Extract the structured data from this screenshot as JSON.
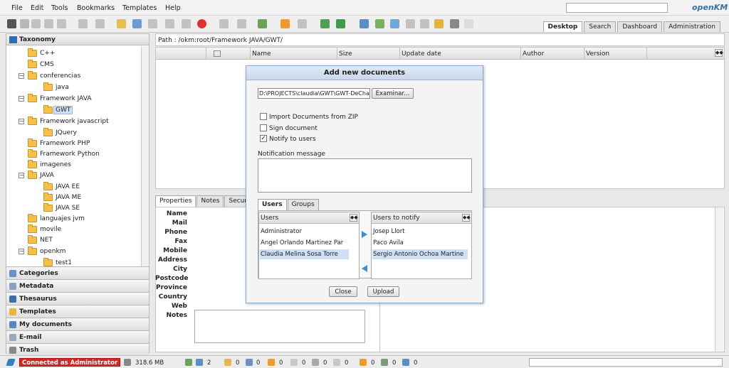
{
  "menu": [
    "File",
    "Edit",
    "Tools",
    "Bookmarks",
    "Templates",
    "Help"
  ],
  "logo": "openKM",
  "top_tabs": [
    {
      "label": "Desktop",
      "active": true
    },
    {
      "label": "Search",
      "active": false
    },
    {
      "label": "Dashboard",
      "active": false
    },
    {
      "label": "Administration",
      "active": false
    }
  ],
  "taxonomy": {
    "title": "Taxonomy",
    "nodes": [
      {
        "label": "C++",
        "expand": ""
      },
      {
        "label": "CMS",
        "expand": ""
      },
      {
        "label": "conferencias",
        "expand": "−"
      },
      {
        "label": "java",
        "expand": ""
      },
      {
        "label": "Framework JAVA",
        "expand": "−"
      },
      {
        "label": "GWT",
        "expand": ""
      },
      {
        "label": "Framework javascript",
        "expand": "−"
      },
      {
        "label": "JQuery",
        "expand": ""
      },
      {
        "label": "Framework PHP",
        "expand": ""
      },
      {
        "label": "Framework Python",
        "expand": ""
      },
      {
        "label": "imagenes",
        "expand": ""
      },
      {
        "label": "JAVA",
        "expand": "−"
      },
      {
        "label": "JAVA EE",
        "expand": ""
      },
      {
        "label": "JAVA ME",
        "expand": ""
      },
      {
        "label": "JAVA SE",
        "expand": ""
      },
      {
        "label": "languajes jvm",
        "expand": ""
      },
      {
        "label": "movile",
        "expand": ""
      },
      {
        "label": "NET",
        "expand": ""
      },
      {
        "label": "openkm",
        "expand": "−"
      },
      {
        "label": "test1",
        "expand": ""
      }
    ]
  },
  "accordion": [
    "Categories",
    "Metadata",
    "Thesaurus",
    "Templates",
    "My documents",
    "E-mail",
    "Trash"
  ],
  "path": "Path : /okm:root/Framework JAVA/GWT/",
  "grid_columns": [
    "Name",
    "Size",
    "Update date",
    "Author",
    "Version"
  ],
  "property_tabs": [
    "Properties",
    "Notes",
    "Security"
  ],
  "property_labels": [
    "Name",
    "Mail",
    "Phone",
    "Fax",
    "Mobile",
    "Address",
    "City",
    "Postcode",
    "Province",
    "Country",
    "Web",
    "Notes"
  ],
  "dialog": {
    "title": "Add new documents",
    "file_value": "D:\\PROJECTS\\claudia\\GWT\\GWT-DeCharla",
    "browse_label": "Examinar...",
    "options": [
      {
        "label": "Import Documents from ZIP",
        "checked": false
      },
      {
        "label": "Sign document",
        "checked": false
      },
      {
        "label": "Notify to users",
        "checked": true
      }
    ],
    "notification_label": "Notification message",
    "tabs": [
      "Users",
      "Groups"
    ],
    "users_header": "Users",
    "users": [
      "Administrator",
      "Angel Orlando Martinez Par",
      "Claudia Melina Sosa Torre"
    ],
    "notify_header": "Users to notify",
    "notify": [
      "Josep Llort",
      "Paco Avila",
      "Sergio Antonio Ochoa Martine"
    ],
    "close_label": "Close",
    "upload_label": "Upload"
  },
  "status": {
    "connected": "Connected as Administrator",
    "size": "318.6 MB",
    "counters": [
      "2",
      "0",
      "0",
      "0",
      "0",
      "0",
      "0",
      "0",
      "0",
      "0"
    ]
  }
}
